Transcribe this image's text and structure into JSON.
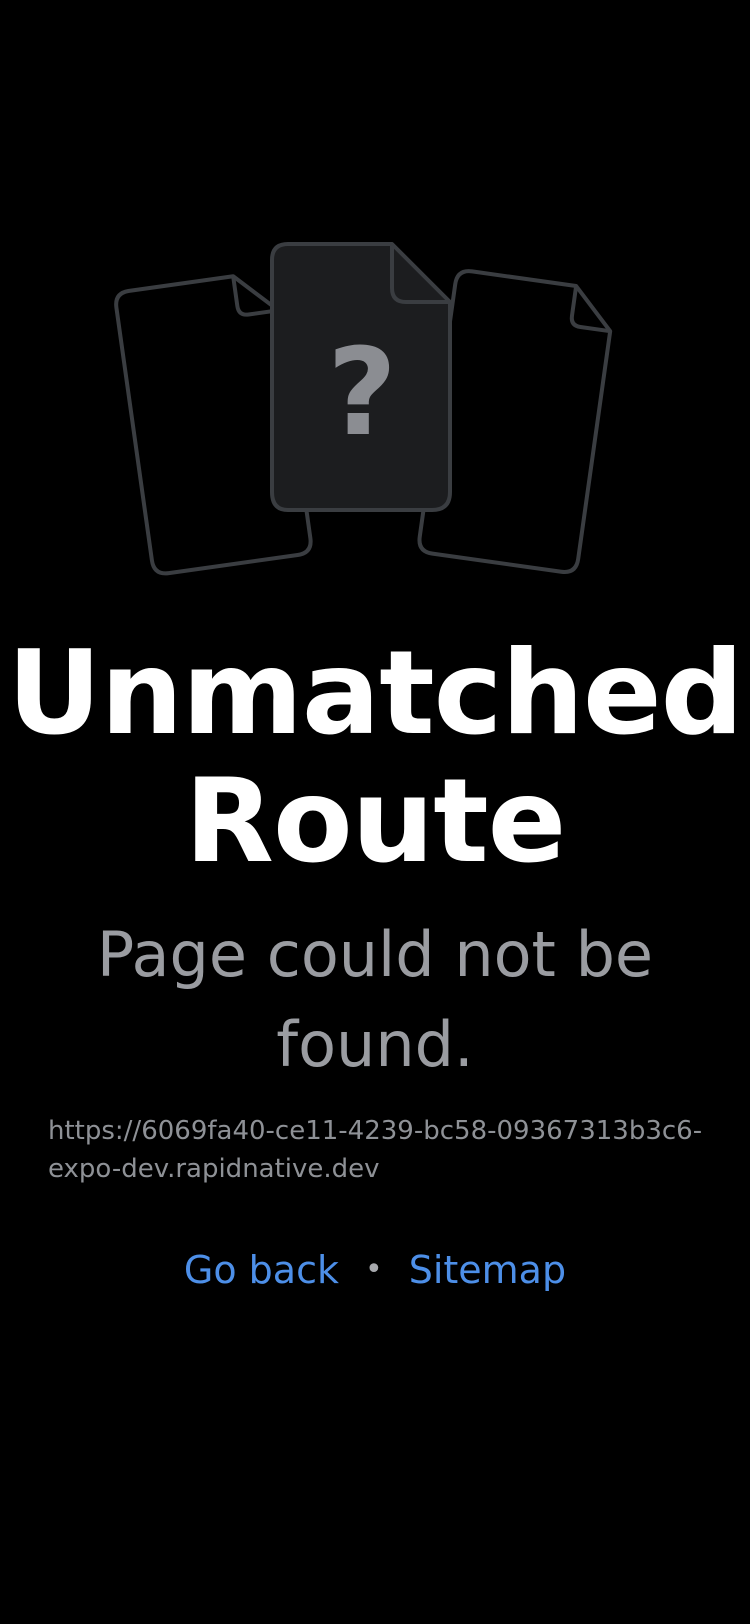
{
  "title": "Unmatched Route",
  "subtitle": "Page could not be found.",
  "url": "https://6069fa40-ce11-4239-bc58-09367313b3c6-expo-dev.rapidnative.dev",
  "links": {
    "go_back": "Go back",
    "separator": "•",
    "sitemap": "Sitemap"
  },
  "illustration": {
    "icon": "file-question-icon",
    "glyph": "?"
  },
  "colors": {
    "background": "#000000",
    "title": "#ffffff",
    "subtitle": "#9a9ca1",
    "link": "#4d8fe8",
    "file_outline": "#3a3d41",
    "file_fill": "#1c1d1f",
    "question_mark": "#8b8d92"
  }
}
